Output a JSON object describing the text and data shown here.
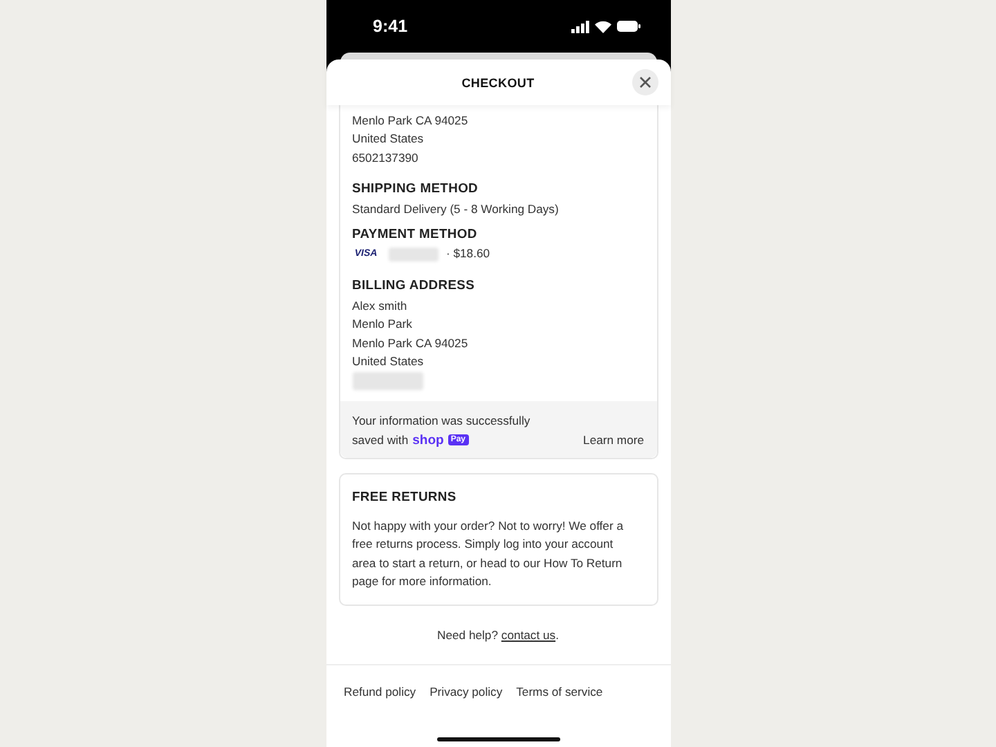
{
  "status_bar": {
    "time": "9:41"
  },
  "header": {
    "title": "CHECKOUT"
  },
  "shipping_address_lines": [
    "Menlo Park CA 94025",
    "United States",
    "6502137390"
  ],
  "shipping_method": {
    "heading": "SHIPPING METHOD",
    "value": "Standard Delivery (5 - 8 Working Days)"
  },
  "payment_method": {
    "heading": "PAYMENT METHOD",
    "card_brand": "VISA",
    "amount": "· $18.60"
  },
  "billing_address": {
    "heading": "BILLING ADDRESS",
    "lines": [
      "Alex smith",
      "Menlo Park",
      "Menlo Park CA 94025",
      "United States"
    ]
  },
  "shop_pay_notice": {
    "line1": "Your information was successfully",
    "line2": "saved with",
    "logo_word": "shop",
    "logo_badge": "Pay",
    "link": "Learn more"
  },
  "free_returns": {
    "heading": "FREE RETURNS",
    "text": "Not happy with your order? Not to worry! We offer a free returns process. Simply log into your account area to start a return, or head to our How To Return page for more information."
  },
  "help": {
    "text": "Need help?",
    "link": "contact us",
    "after": "."
  },
  "footer_links": [
    "Refund policy",
    "Privacy policy",
    "Terms of service"
  ]
}
